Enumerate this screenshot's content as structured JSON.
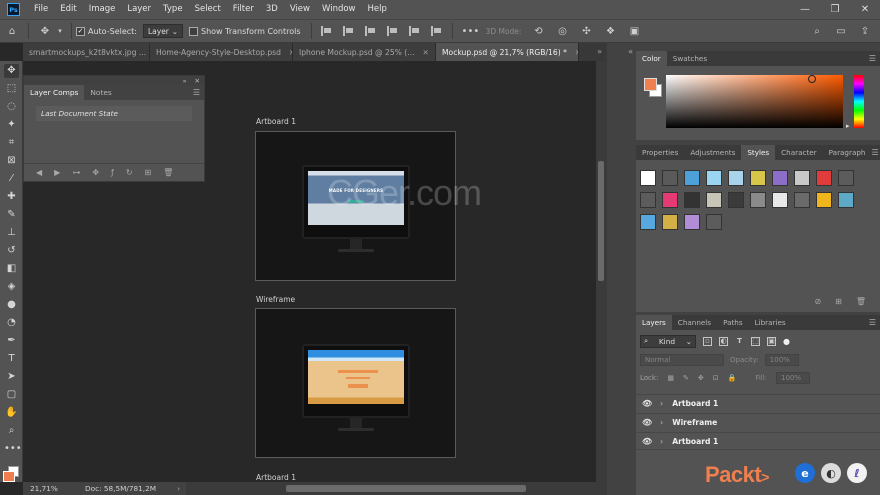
{
  "app": {
    "logo": "Ps",
    "menu": [
      "File",
      "Edit",
      "Image",
      "Layer",
      "Type",
      "Select",
      "Filter",
      "3D",
      "View",
      "Window",
      "Help"
    ],
    "window_controls": [
      "—",
      "❐",
      "✕"
    ]
  },
  "options_bar": {
    "home_icon": "home-icon",
    "auto_select_label": "Auto-Select:",
    "auto_select_checked": true,
    "auto_select_value": "Layer",
    "transform_controls_label": "Show Transform Controls",
    "transform_controls_checked": false,
    "more_label": "•••",
    "mode_3d_label": "3D Mode:"
  },
  "tabs": [
    {
      "label": "smartmockups_k2t8vktx.jpg ...",
      "active": false
    },
    {
      "label": "Home-Agency-Style-Desktop.psd",
      "active": false
    },
    {
      "label": "Iphone Mockup.psd @ 25% (...",
      "active": false
    },
    {
      "label": "Mockup.psd @ 21,7% (RGB/16) *",
      "active": true
    }
  ],
  "layer_comps_panel": {
    "tabs": [
      "Layer Comps",
      "Notes"
    ],
    "active_tab": "Layer Comps",
    "rows": [
      "Last Document State"
    ]
  },
  "canvas": {
    "artboards": [
      {
        "label": "Artboard 1",
        "screen": "blue"
      },
      {
        "label": "Wireframe",
        "screen": "wire"
      },
      {
        "label": "Artboard 1",
        "screen": "none"
      }
    ],
    "screen_caption": "MADE FOR DESIGNERS",
    "watermark": "CGer.com"
  },
  "status": {
    "zoom": "21,71%",
    "doc_info": "Doc: 58,5M/781,2M"
  },
  "color_panel": {
    "tabs": [
      "Color",
      "Swatches"
    ],
    "active_tab": "Color",
    "foreground": "#f07f50",
    "background": "#ffffff"
  },
  "styles_panel": {
    "tabs": [
      "Properties",
      "Adjustments",
      "Styles",
      "Character",
      "Paragraph"
    ],
    "active_tab": "Styles",
    "swatches": [
      "#ffffff",
      "#5a5a5a",
      "#4ea1d8",
      "#9ad5f2",
      "#a9d3ea",
      "#d8c64a",
      "#8c6ec9",
      "#c9c9c9",
      "#e03c3c",
      "#5c5c5c",
      "#5c5c5c",
      "#e63a75",
      "#333333",
      "#c9c4b8",
      "#3b3b3b",
      "#8a8a8a",
      "#e8e8e8",
      "#6a6a6a",
      "#f0b41c",
      "#5fa9c8",
      "#58a8e0",
      "#d2b046",
      "#b08dd6",
      "#5c5c5c"
    ]
  },
  "layers_panel": {
    "tabs": [
      "Layers",
      "Channels",
      "Paths",
      "Libraries"
    ],
    "active_tab": "Layers",
    "kind_label": "Kind",
    "blend_mode": "Normal",
    "opacity_label": "Opacity:",
    "opacity_value": "100%",
    "lock_label": "Lock:",
    "fill_label": "Fill:",
    "fill_value": "100%",
    "layers": [
      "Artboard 1",
      "Wireframe",
      "Artboard 1"
    ]
  },
  "brand": {
    "logo_text": "Packt",
    "logo_arrow": ">"
  }
}
